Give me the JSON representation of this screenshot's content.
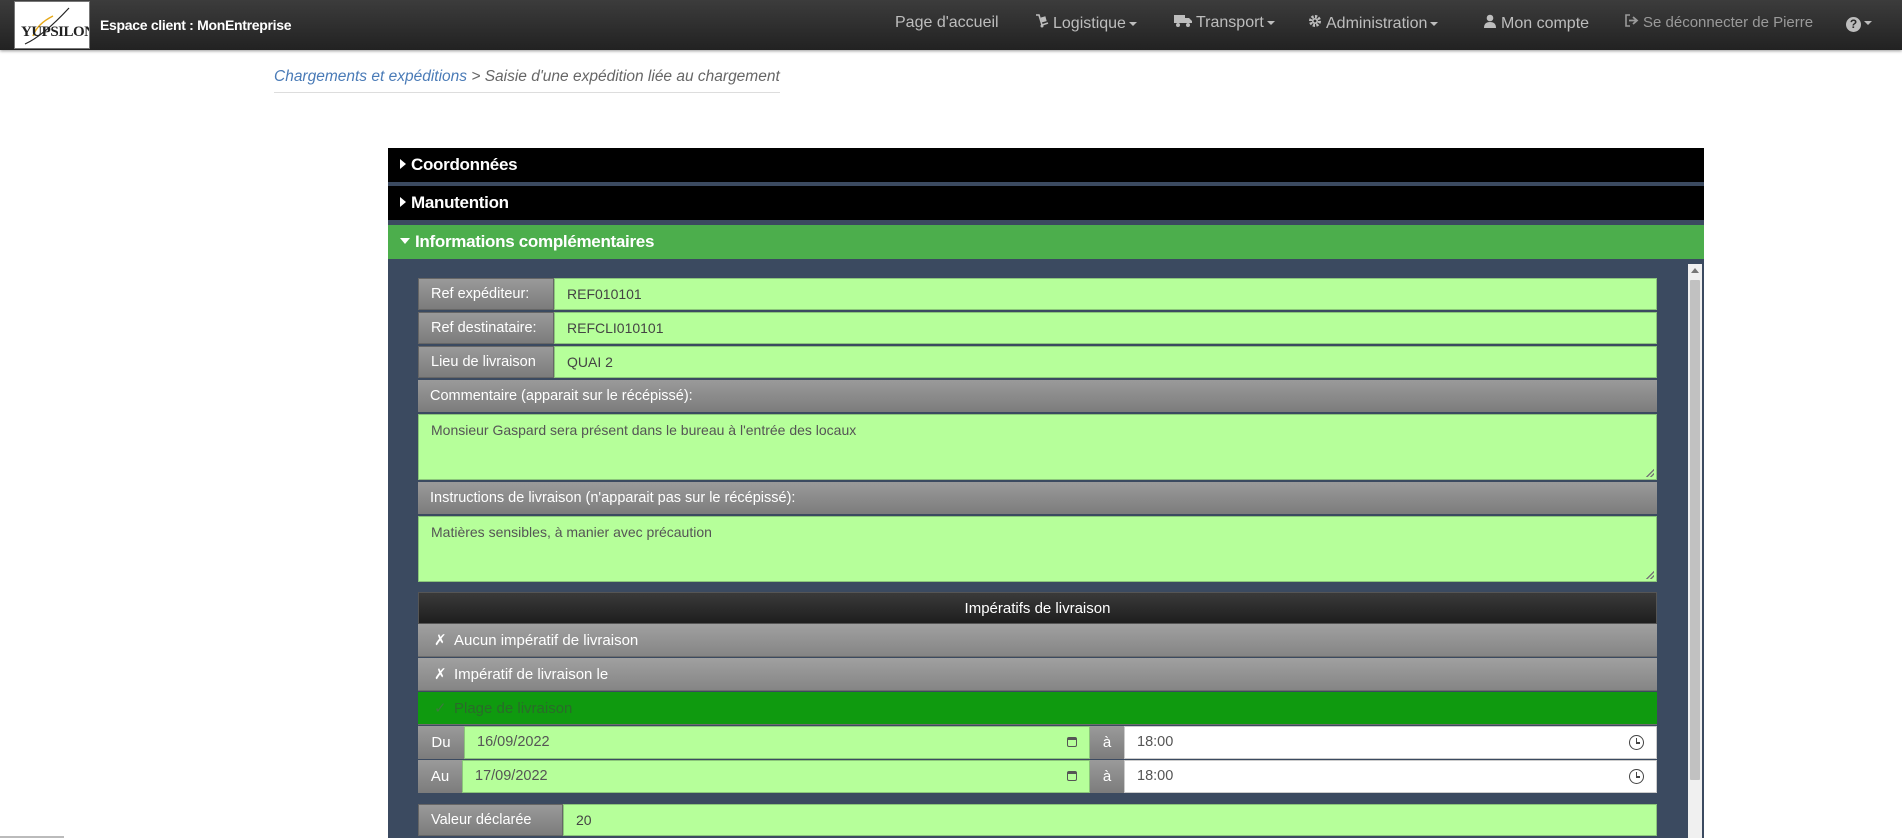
{
  "header": {
    "logo_text": "YUPSILON",
    "brand": "Espace client : MonEntreprise",
    "nav": {
      "home": "Page d'accueil",
      "logistique": "Logistique",
      "transport": "Transport",
      "administration": "Administration",
      "account": "Mon compte",
      "logout": "Se déconnecter de Pierre"
    }
  },
  "breadcrumb": {
    "link": "Chargements et expéditions",
    "separator": " > ",
    "current": "Saisie d'une expédition liée au chargement"
  },
  "accordion": {
    "coordonnees": "Coordonnées",
    "manutention": "Manutention",
    "infos": "Informations complémentaires"
  },
  "form": {
    "ref_expediteur": {
      "label": "Ref expéditeur:",
      "value": "REF010101"
    },
    "ref_destinataire": {
      "label": "Ref destinataire:",
      "value": "REFCLI010101"
    },
    "lieu_livraison": {
      "label": "Lieu de livraison",
      "value": "QUAI 2"
    },
    "commentaire": {
      "label": "Commentaire (apparait sur le récépissé):",
      "value": "Monsieur Gaspard sera présent dans le bureau à l'entrée des locaux"
    },
    "instructions": {
      "label": "Instructions de livraison (n'apparait pas sur le récépissé):",
      "value": "Matières sensibles, à manier avec précaution"
    },
    "imperatifs": {
      "title": "Impératifs de livraison",
      "options": [
        {
          "mark": "✗",
          "label": "Aucun impératif de livraison",
          "selected": false
        },
        {
          "mark": "✗",
          "label": "Impératif de livraison le",
          "selected": false
        },
        {
          "mark": "✓",
          "label": "Plage de livraison",
          "selected": true
        }
      ],
      "du": {
        "label": "Du",
        "date": "16/09/2022",
        "a_label": "à",
        "time": "18:00"
      },
      "au": {
        "label": "Au",
        "date": "17/09/2022",
        "a_label": "à",
        "time": "18:00"
      }
    },
    "valeur_declaree": {
      "label": "Valeur déclarée",
      "value": "20"
    }
  },
  "colors": {
    "navbar": "#2b2b2b",
    "open_header": "#4cae4c",
    "input_bg": "#b6ff9a",
    "selected_option": "#0f9a0f",
    "panel_bg": "#3b4a60"
  }
}
